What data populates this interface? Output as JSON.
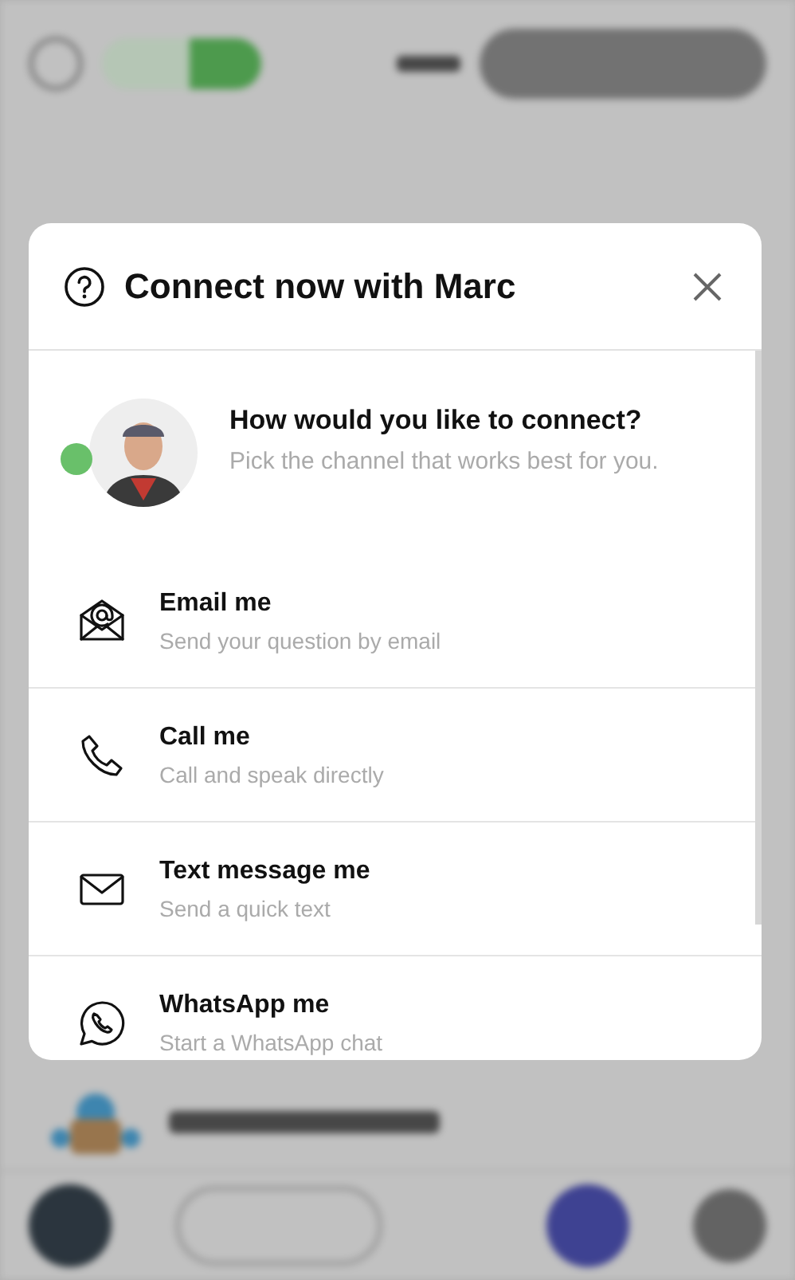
{
  "dialog": {
    "title": "Connect now with Marc"
  },
  "intro": {
    "online": true,
    "title": "How would you like to connect?",
    "subtitle": "Pick the channel that works best for you."
  },
  "channels": [
    {
      "kind": "email",
      "title": "Email me",
      "subtitle": "Send your question by email"
    },
    {
      "kind": "phone",
      "title": "Call me",
      "subtitle": "Call and speak directly"
    },
    {
      "kind": "sms",
      "title": "Text message me",
      "subtitle": "Send a quick text"
    },
    {
      "kind": "whatsapp",
      "title": "WhatsApp me",
      "subtitle": "Start a WhatsApp chat"
    }
  ]
}
